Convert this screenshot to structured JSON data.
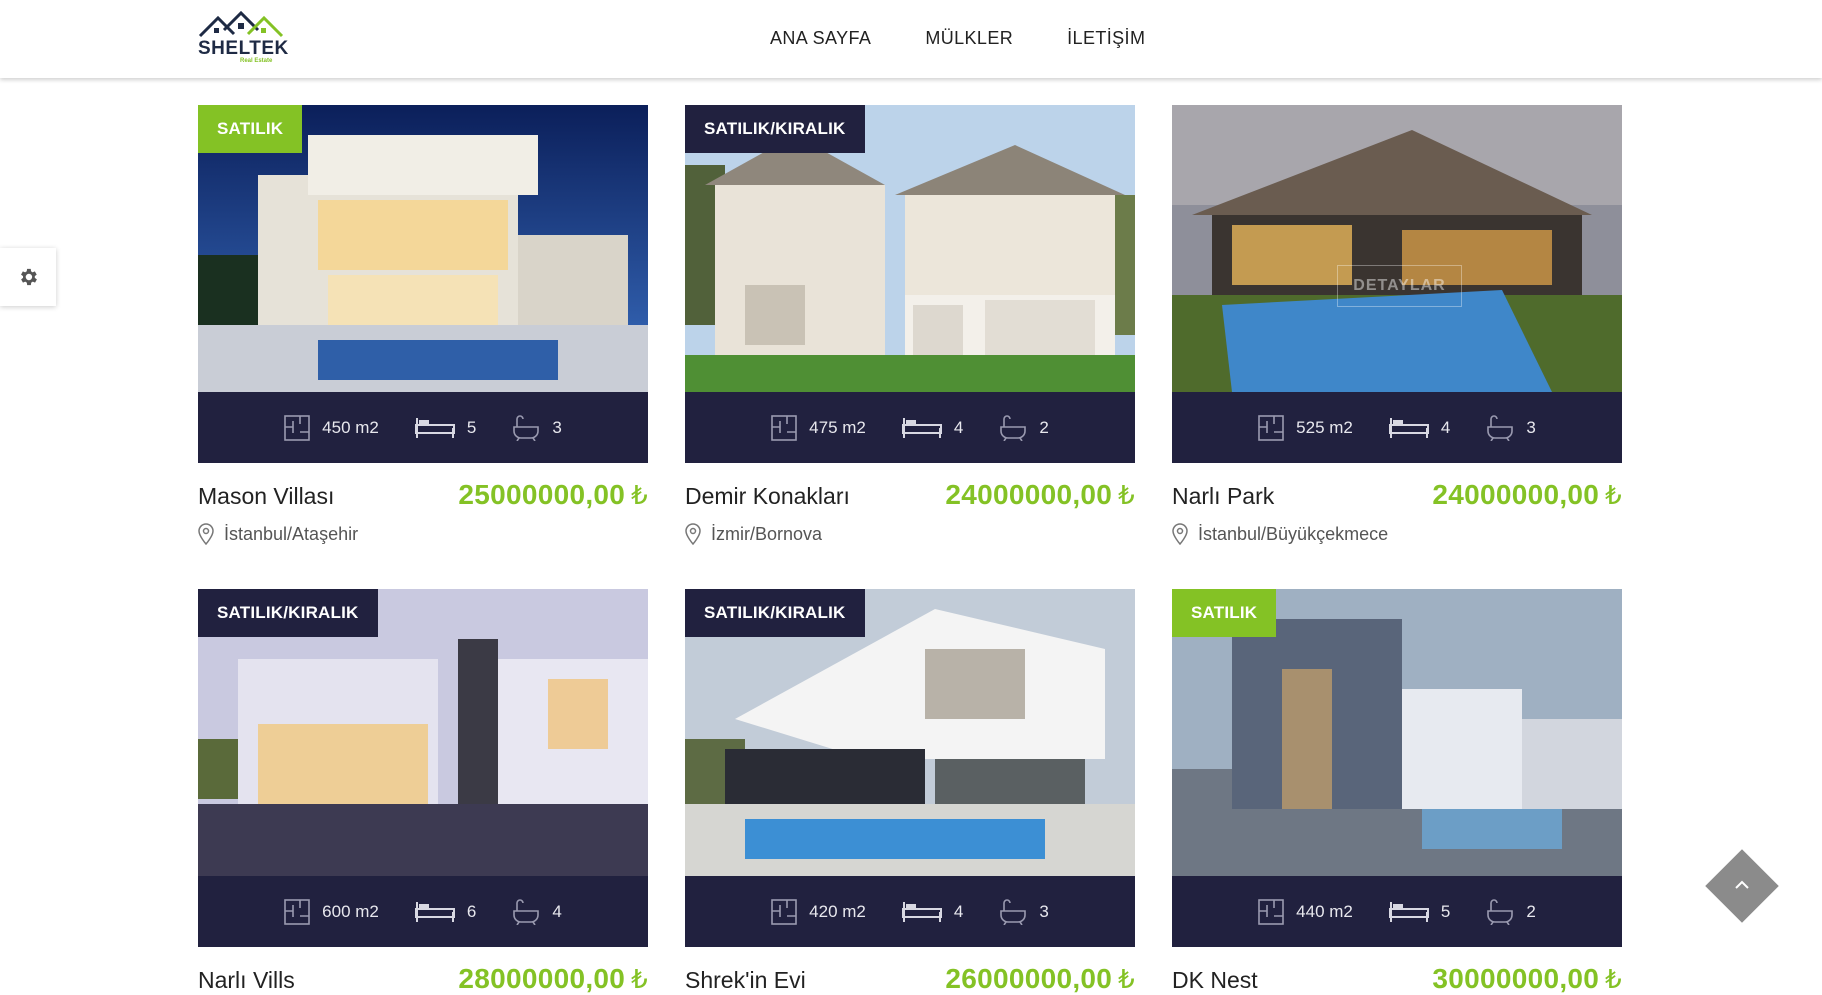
{
  "brand": {
    "name": "SHELTEK",
    "tagline": "Real Estate"
  },
  "nav": [
    {
      "label": "ANA SAYFA"
    },
    {
      "label": "MÜLKLER"
    },
    {
      "label": "İLETİŞİM"
    }
  ],
  "currency_symbol": "₺",
  "hover_overlay_label": "DETAYLAR",
  "listings": [
    {
      "badge": "SATILIK",
      "badge_style": "green",
      "area": "450 m2",
      "beds": "5",
      "baths": "3",
      "title": "Mason Villası",
      "price": "25000000,00",
      "location": "İstanbul/Ataşehir"
    },
    {
      "badge": "SATILIK/KIRALIK",
      "badge_style": "dark",
      "area": "475 m2",
      "beds": "4",
      "baths": "2",
      "title": "Demir Konakları",
      "price": "24000000,00",
      "location": "İzmir/Bornova"
    },
    {
      "badge": "",
      "badge_style": "none",
      "area": "525 m2",
      "beds": "4",
      "baths": "3",
      "title": "Narlı Park",
      "price": "24000000,00",
      "location": "İstanbul/Büyükçekmece"
    },
    {
      "badge": "SATILIK/KIRALIK",
      "badge_style": "dark",
      "area": "600 m2",
      "beds": "6",
      "baths": "4",
      "title": "Narlı Vills",
      "price": "28000000,00",
      "location": ""
    },
    {
      "badge": "SATILIK/KIRALIK",
      "badge_style": "dark",
      "area": "420 m2",
      "beds": "4",
      "baths": "3",
      "title": "Shrek'in Evi",
      "price": "26000000,00",
      "location": ""
    },
    {
      "badge": "SATILIK",
      "badge_style": "green",
      "area": "440 m2",
      "beds": "5",
      "baths": "2",
      "title": "DK Nest",
      "price": "30000000,00",
      "location": ""
    }
  ],
  "colors": {
    "accent": "#84c225",
    "dark": "#21213f",
    "text": "#222222"
  },
  "icons": {
    "settings": "gear-icon",
    "back_to_top": "chevron-up-icon",
    "area": "floorplan-icon",
    "beds": "bed-icon",
    "baths": "bathtub-icon",
    "location": "map-pin-icon"
  }
}
